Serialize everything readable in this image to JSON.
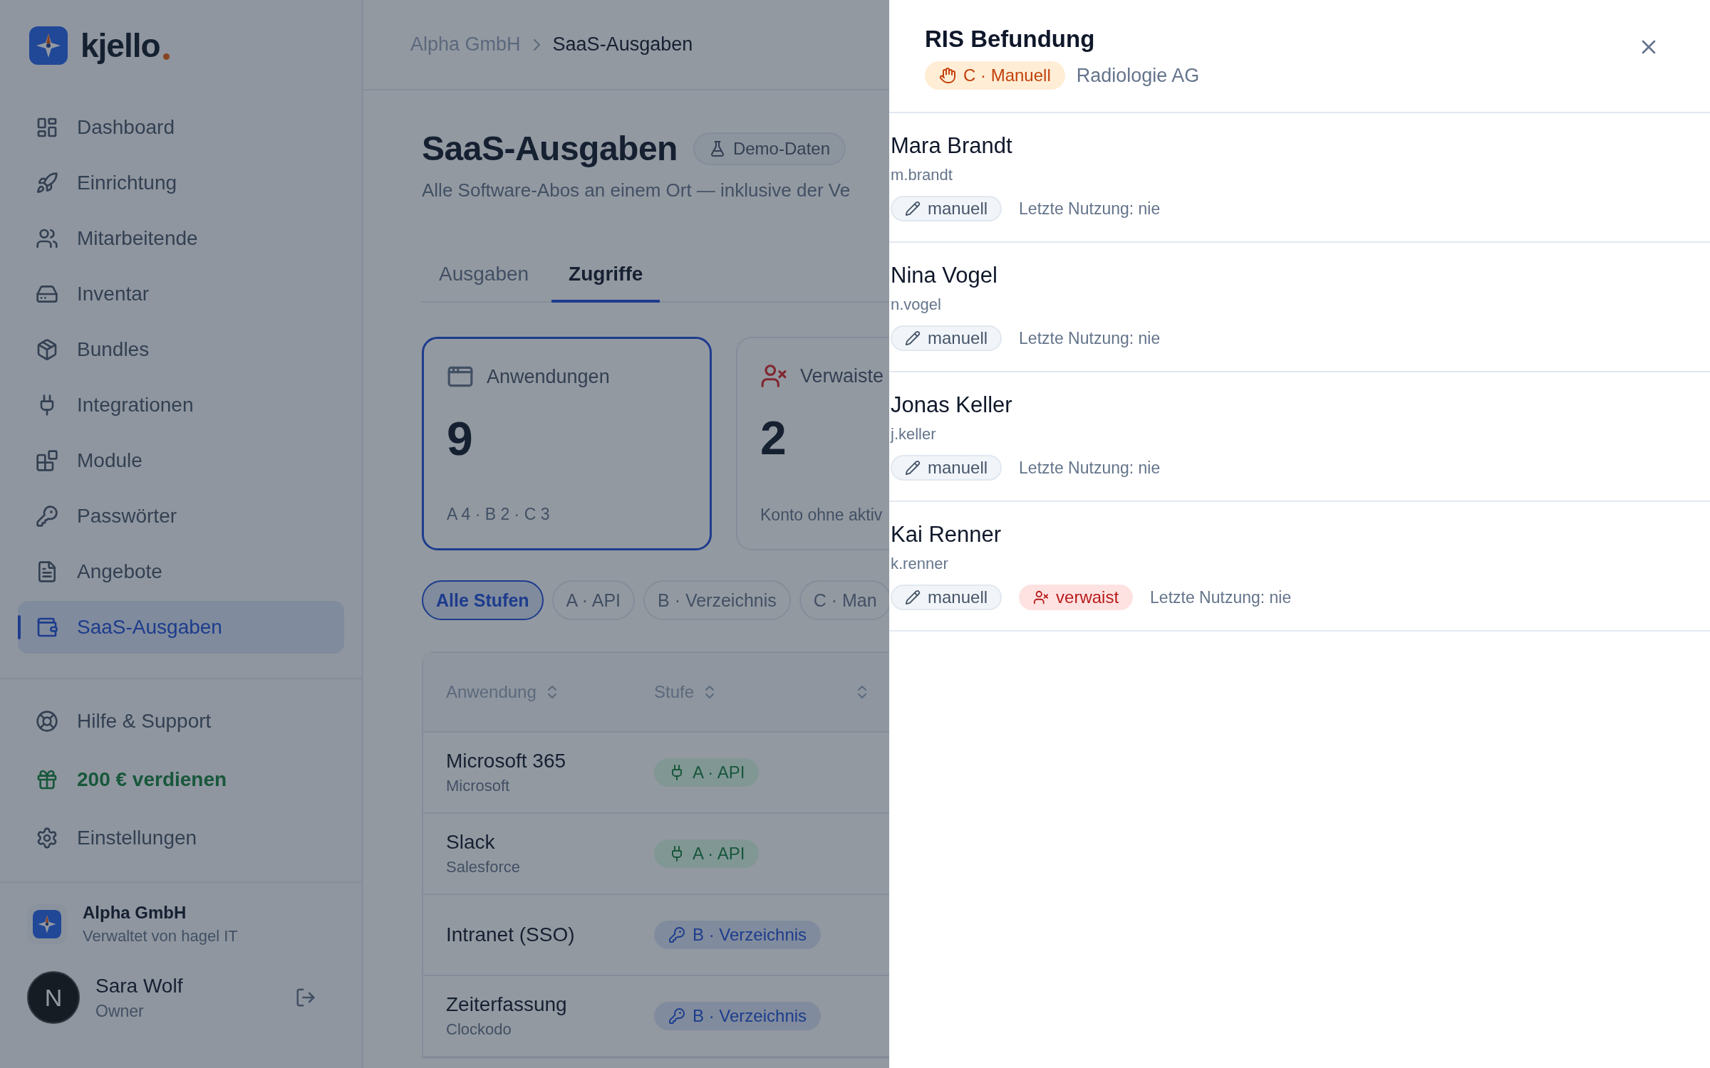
{
  "brand": {
    "name": "kjello"
  },
  "sidebar": {
    "items": [
      {
        "label": "Dashboard",
        "selected": false
      },
      {
        "label": "Einrichtung",
        "selected": false
      },
      {
        "label": "Mitarbeitende",
        "selected": false
      },
      {
        "label": "Inventar",
        "selected": false
      },
      {
        "label": "Bundles",
        "selected": false
      },
      {
        "label": "Integrationen",
        "selected": false
      },
      {
        "label": "Module",
        "selected": false
      },
      {
        "label": "Passwörter",
        "selected": false
      },
      {
        "label": "Angebote",
        "selected": false
      },
      {
        "label": "SaaS-Ausgaben",
        "selected": true
      }
    ],
    "footer_items": [
      {
        "label": "Hilfe & Support",
        "kind": "link"
      },
      {
        "label": "200 € verdienen",
        "kind": "promo"
      },
      {
        "label": "Einstellungen",
        "kind": "link"
      }
    ],
    "organization": {
      "name": "Alpha GmbH",
      "subtitle": "Verwaltet von hagel IT"
    },
    "user": {
      "initial": "N",
      "name": "Sara Wolf",
      "role": "Owner"
    }
  },
  "breadcrumb": [
    "Alpha GmbH",
    "SaaS-Ausgaben"
  ],
  "page": {
    "title": "SaaS-Ausgaben",
    "badge": "Demo-Daten",
    "subtitle": "Alle Software-Abos an einem Ort — inklusive der Ve"
  },
  "tabs": [
    {
      "label": "Ausgaben",
      "selected": false
    },
    {
      "label": "Zugriffe",
      "selected": true
    }
  ],
  "stats": [
    {
      "kind": "apps",
      "label": "Anwendungen",
      "value": "9",
      "detail": "A 4 · B 2 · C 3",
      "selected": true
    },
    {
      "kind": "orphaned",
      "label": "Verwaiste",
      "value": "2",
      "detail": "Konto ohne aktiv",
      "selected": false
    }
  ],
  "filters": [
    {
      "label": "Alle Stufen",
      "selected": true
    },
    {
      "label": "A · API",
      "selected": false
    },
    {
      "label": "B · Verzeichnis",
      "selected": false
    },
    {
      "label": "C · Man",
      "selected": false
    }
  ],
  "table": {
    "columns": [
      "Anwendung",
      "Stufe"
    ],
    "rows": [
      {
        "name": "Microsoft 365",
        "vendor": "Microsoft",
        "tier": {
          "kind": "api",
          "label": "A · API"
        }
      },
      {
        "name": "Slack",
        "vendor": "Salesforce",
        "tier": {
          "kind": "api",
          "label": "A · API"
        }
      },
      {
        "name": "Intranet (SSO)",
        "tier": {
          "kind": "directory",
          "label": "B · Verzeichnis"
        }
      },
      {
        "name": "Zeiterfassung",
        "vendor": "Clockodo",
        "tier": {
          "kind": "directory",
          "label": "B · Verzeichnis"
        }
      }
    ]
  },
  "drawer": {
    "title": "RIS Befundung",
    "badge": {
      "kind": "manual",
      "label": "C · Manuell"
    },
    "vendor": "Radiologie AG",
    "users": [
      {
        "name": "Mara Brandt",
        "login": "m.brandt",
        "tags": [
          {
            "kind": "manual",
            "label": "manuell"
          }
        ],
        "last_used": "Letzte Nutzung: nie"
      },
      {
        "name": "Nina Vogel",
        "login": "n.vogel",
        "tags": [
          {
            "kind": "manual",
            "label": "manuell"
          }
        ],
        "last_used": "Letzte Nutzung: nie"
      },
      {
        "name": "Jonas Keller",
        "login": "j.keller",
        "tags": [
          {
            "kind": "manual",
            "label": "manuell"
          }
        ],
        "last_used": "Letzte Nutzung: nie"
      },
      {
        "name": "Kai Renner",
        "login": "k.renner",
        "tags": [
          {
            "kind": "manual",
            "label": "manuell"
          },
          {
            "kind": "orphaned",
            "label": "verwaist"
          }
        ],
        "last_used": "Letzte Nutzung: nie"
      }
    ]
  }
}
